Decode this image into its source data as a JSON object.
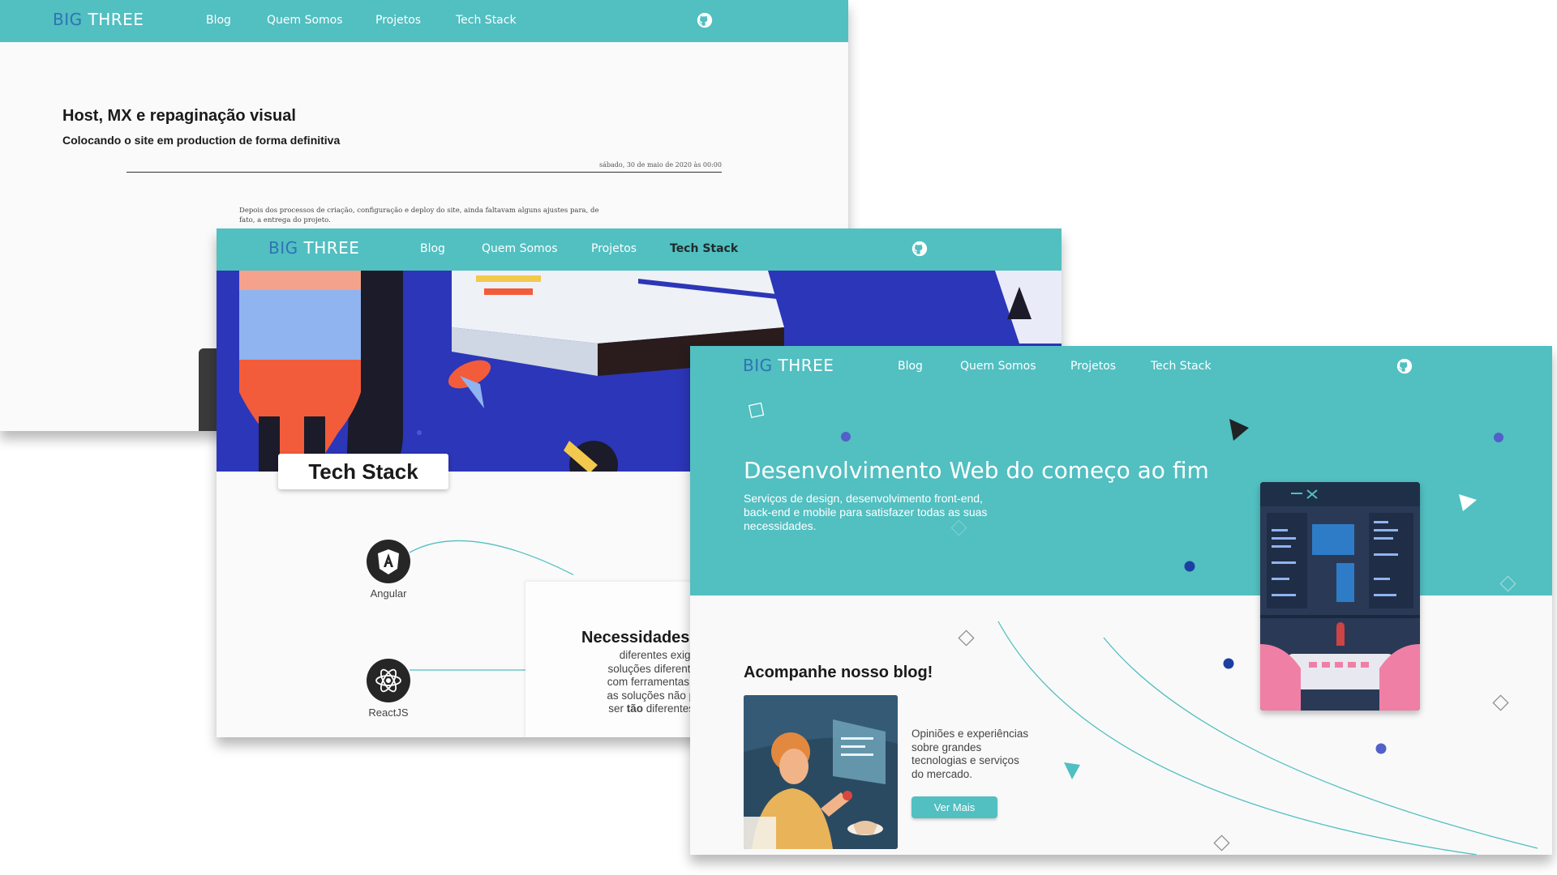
{
  "brand": {
    "logo_big": "BIG",
    "logo_three": "THREE",
    "teal": "#52bfc1",
    "blue": "#2f73b5"
  },
  "nav": {
    "blog": "Blog",
    "about": "Quem Somos",
    "projects": "Projetos",
    "tech_stack": "Tech Stack",
    "github_icon": "github-icon"
  },
  "blog_post": {
    "title": "Host, MX e repaginação visual",
    "subtitle": "Colocando o site em production de forma definitiva",
    "date": "sábado, 30 de maio de 2020 às 00:00",
    "body": "Depois dos processos de criação, configuração e deploy do site, ainda faltavam alguns ajustes para, de fato, a entrega do projeto."
  },
  "tech_stack_page": {
    "label": "Tech Stack",
    "technologies": [
      {
        "name": "Angular",
        "icon": "angular-icon"
      },
      {
        "name": "ReactJS",
        "icon": "react-icon"
      }
    ],
    "card_title": "Necessidades",
    "card_text_line1": "diferentes exigem",
    "card_text_line2": "soluções diferentes. M",
    "card_text_line3": "com ferramentas flexív",
    "card_text_line4": "as soluções não precis",
    "card_text_line5_before": "ser ",
    "card_text_line5_bold": "tão",
    "card_text_line5_after": " diferentes assi"
  },
  "home_page": {
    "headline": "Desenvolvimento Web do começo ao fim",
    "subhead": "Serviços de design, desenvolvimento front-end, back-end e mobile para satisfazer todas as suas necessidades.",
    "blog_heading": "Acompanhe nosso blog!",
    "blog_text": "Opiniões e experiências sobre grandes tecnologias e serviços do mercado.",
    "blog_button": "Ver Mais"
  }
}
